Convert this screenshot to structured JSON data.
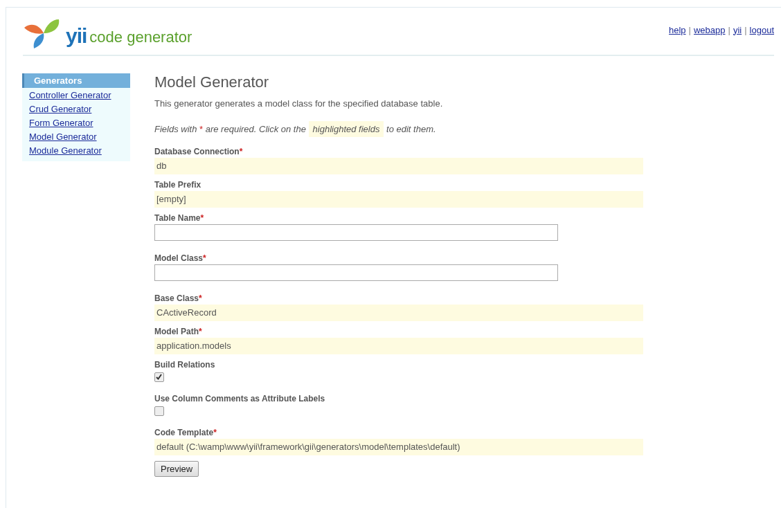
{
  "header": {
    "brand": "yii",
    "subtitle": "code generator",
    "links": [
      {
        "label": "help"
      },
      {
        "label": "webapp"
      },
      {
        "label": "yii"
      },
      {
        "label": "logout"
      }
    ],
    "separator": "|"
  },
  "sidebar": {
    "title": "Generators",
    "items": [
      {
        "label": "Controller Generator"
      },
      {
        "label": "Crud Generator"
      },
      {
        "label": "Form Generator"
      },
      {
        "label": "Model Generator"
      },
      {
        "label": "Module Generator"
      }
    ]
  },
  "main": {
    "title": "Model Generator",
    "description": "This generator generates a model class for the specified database table.",
    "hint": [
      {
        "kind": "text",
        "text": "Fields with "
      },
      {
        "kind": "required",
        "text": "*"
      },
      {
        "kind": "text",
        "text": " are required. Click on the "
      },
      {
        "kind": "highlight",
        "text": "highlighted fields"
      },
      {
        "kind": "text",
        "text": " to edit them."
      }
    ],
    "fields": [
      {
        "kind": "sticky",
        "label": "Database Connection",
        "required": true,
        "value": "db"
      },
      {
        "kind": "sticky",
        "label": "Table Prefix",
        "required": false,
        "value": "[empty]"
      },
      {
        "kind": "text",
        "label": "Table Name",
        "required": true
      },
      {
        "kind": "text",
        "label": "Model Class",
        "required": true
      },
      {
        "kind": "sticky",
        "label": "Base Class",
        "required": true,
        "value": "CActiveRecord"
      },
      {
        "kind": "sticky",
        "label": "Model Path",
        "required": true,
        "value": "application.models"
      },
      {
        "kind": "checkbox",
        "label": "Build Relations",
        "required": false,
        "checked": true
      },
      {
        "kind": "checkbox",
        "label": "Use Column Comments as Attribute Labels",
        "required": false,
        "checked": false
      },
      {
        "kind": "sticky",
        "label": "Code Template",
        "required": true,
        "value": "default (C:\\wamp\\www\\yii\\framework\\gii\\generators\\model\\templates\\default)"
      }
    ],
    "required_mark": "*",
    "button": "Preview"
  }
}
